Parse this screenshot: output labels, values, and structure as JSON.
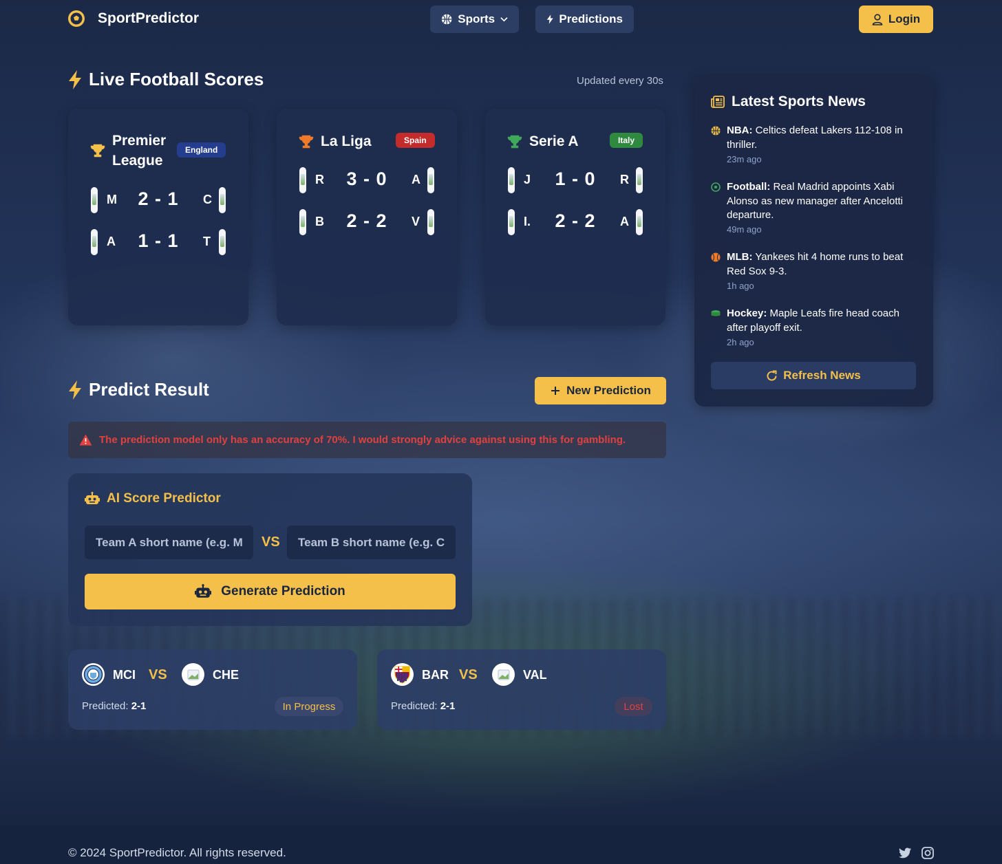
{
  "header": {
    "brand": "SportPredictor",
    "nav_sports": "Sports",
    "nav_predictions": "Predictions",
    "login": "Login"
  },
  "live": {
    "title": "Live Football Scores",
    "updated": "Updated every 30s",
    "leagues": [
      {
        "name_line1": "Premier",
        "name_line2": "League",
        "country": "England",
        "country_color": "#253d8f",
        "trophy_color": "#f4c04a",
        "matches": [
          {
            "home": "M",
            "score": "2 - 1",
            "away": "C"
          },
          {
            "home": "A",
            "score": "1 - 1",
            "away": "T"
          }
        ]
      },
      {
        "name": "La Liga",
        "country": "Spain",
        "country_color": "#c42b2b",
        "trophy_color": "#ef7a2a",
        "matches": [
          {
            "home": "R",
            "score": "3 - 0",
            "away": "A"
          },
          {
            "home": "B",
            "score": "2 - 2",
            "away": "V"
          }
        ]
      },
      {
        "name": "Serie A",
        "country": "Italy",
        "country_color": "#2f8a3f",
        "trophy_color": "#3fa85a",
        "matches": [
          {
            "home": "J",
            "score": "1 - 0",
            "away": "R"
          },
          {
            "home": "I.",
            "score": "2 - 2",
            "away": "A"
          }
        ]
      }
    ]
  },
  "news": {
    "title": "Latest Sports News",
    "items": [
      {
        "sport": "NBA:",
        "text": "Celtics defeat Lakers 112-108 in thriller.",
        "time": "23m ago",
        "icon": "basketball-icon",
        "color": "#f4c04a"
      },
      {
        "sport": "Football:",
        "text": "Real Madrid appoints Xabi Alonso as new manager after Ancelotti departure.",
        "time": "49m ago",
        "icon": "soccer-ball-icon",
        "color": "#3fa85a"
      },
      {
        "sport": "MLB:",
        "text": "Yankees hit 4 home runs to beat Red Sox 9-3.",
        "time": "1h ago",
        "icon": "baseball-icon",
        "color": "#ef7a2a"
      },
      {
        "sport": "Hockey:",
        "text": "Maple Leafs fire head coach after playoff exit.",
        "time": "2h ago",
        "icon": "hockey-puck-icon",
        "color": "#3fa85a"
      }
    ],
    "refresh": "Refresh News"
  },
  "predict": {
    "title": "Predict Result",
    "new_prediction": "New Prediction",
    "warning": "The prediction model only has an accuracy of 70%. I would strongly advice against using this for gambling.",
    "ai_title": "AI Score Predictor",
    "team_a_placeholder": "Team A short name (e.g. MCI)",
    "team_b_placeholder": "Team B short name (e.g. CHE)",
    "vs": "VS",
    "generate": "Generate Prediction",
    "cards": [
      {
        "team_a": "MCI",
        "team_b": "CHE",
        "vs": "VS",
        "predicted_label": "Predicted:",
        "predicted": "2-1",
        "status": "In Progress",
        "status_color": "#f4c04a"
      },
      {
        "team_a": "BAR",
        "team_b": "VAL",
        "vs": "VS",
        "predicted_label": "Predicted:",
        "predicted": "2-1",
        "status": "Lost",
        "status_color": "#e0413f"
      }
    ]
  },
  "footer": {
    "copyright": "© 2024 SportPredictor. All rights reserved."
  },
  "colors": {
    "accent": "#f4c04a",
    "danger": "#e0413f",
    "card": "#1e2c4e"
  }
}
